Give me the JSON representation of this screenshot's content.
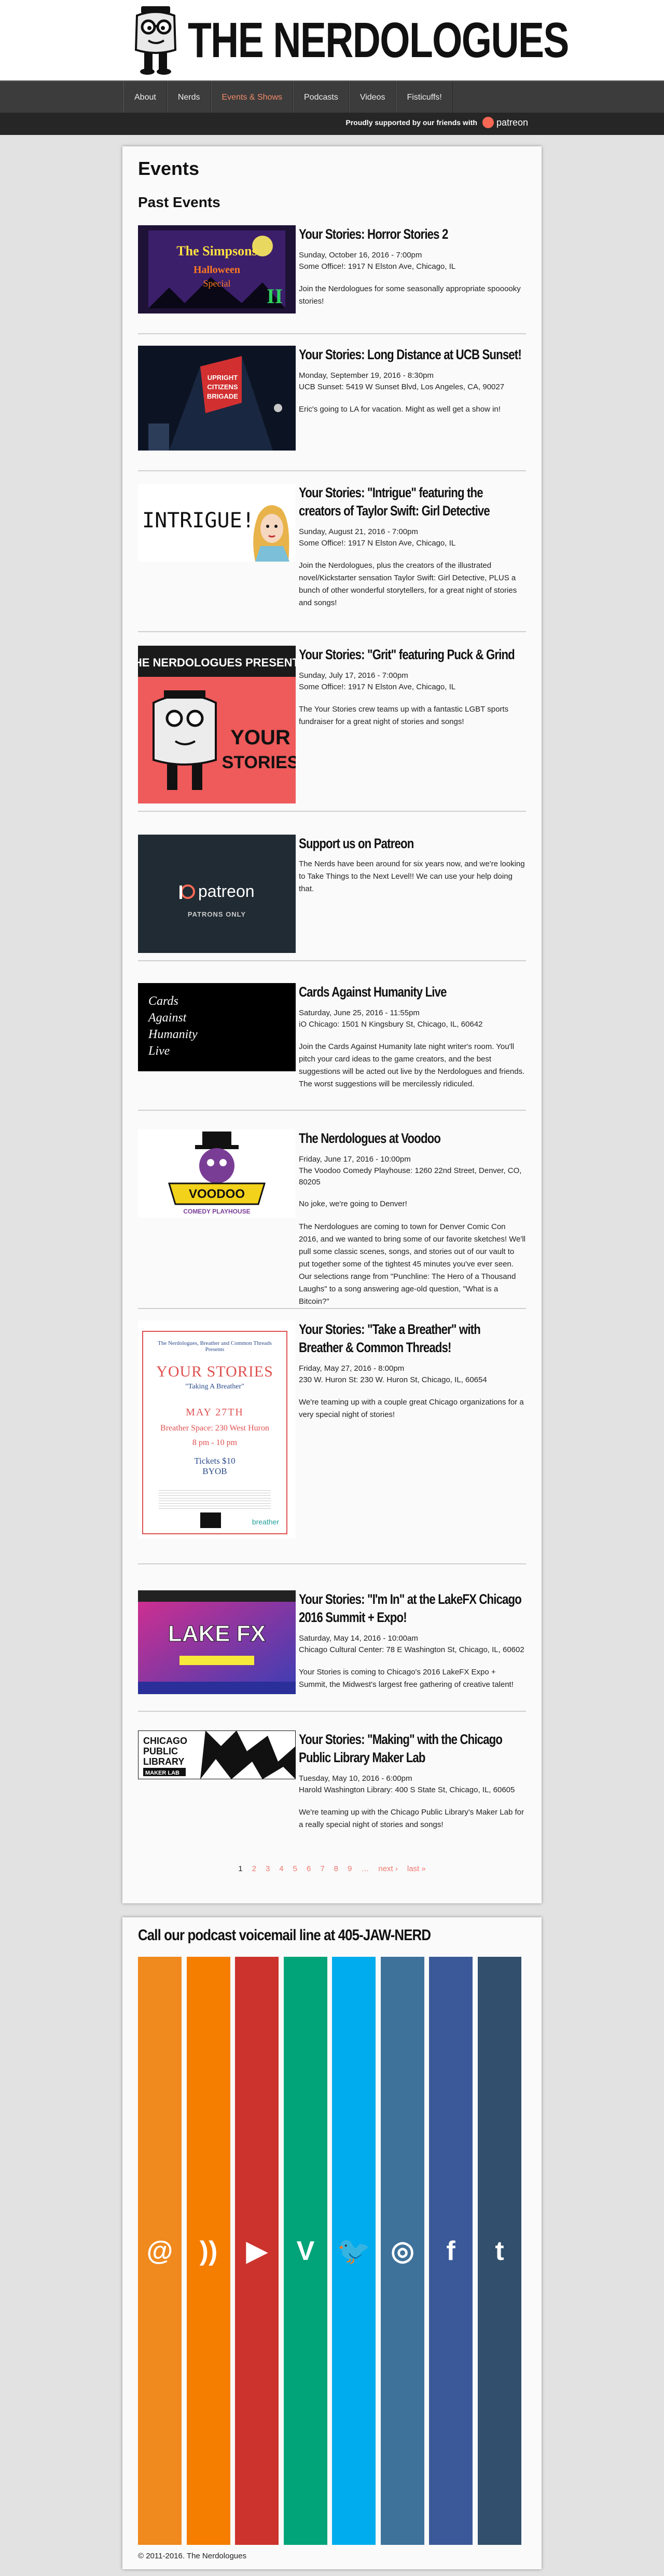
{
  "site": {
    "title": "THE NERDOLOGUES"
  },
  "nav": {
    "items": [
      "About",
      "Nerds",
      "Events & Shows",
      "Podcasts",
      "Videos",
      "Fisticuffs!"
    ],
    "active": 2
  },
  "sponsor": {
    "text": "Proudly supported by our friends with",
    "brand": "patreon",
    "brand_color": "#f96854"
  },
  "main": {
    "page_title": "Events",
    "section_title": "Past Events",
    "events": [
      {
        "title": "Your Stories: Horror Stories 2",
        "date": "Sunday, October 16, 2016 - 7:00pm",
        "location": "Some Office!: 1917 N Elston Ave, Chicago, IL",
        "description": "Join the Nerdologues for some seasonally appropriate spooooky stories!",
        "thumb_text": "The Simpsons Halloween Special"
      },
      {
        "title": "Your Stories: Long Distance at UCB Sunset!",
        "date": "Monday, September 19, 2016 - 8:30pm",
        "location": "UCB Sunset: 5419 W Sunset Blvd, Los Angeles, CA, 90027",
        "description": "Eric's going to LA for vacation. Might as well get a show in!",
        "thumb_text": "UPRIGHT CITIZENS BRIGADE"
      },
      {
        "title": "Your Stories: \"Intrigue\" featuring the creators of Taylor Swift: Girl Detective",
        "date": "Sunday, August 21, 2016 - 7:00pm",
        "location": "Some Office!: 1917 N Elston Ave, Chicago, IL",
        "description": "Join the Nerdologues, plus the creators of the illustrated novel/Kickstarter sensation Taylor Swift: Girl Detective, PLUS a bunch of other wonderful storytellers, for a great night of stories and songs!",
        "thumb_text": "INTRIGUE!"
      },
      {
        "title": "Your Stories: \"Grit\" featuring Puck & Grind",
        "date": "Sunday, July 17, 2016 - 7:00pm",
        "location": "Some Office!: 1917 N Elston Ave, Chicago, IL",
        "description": "The Your Stories crew teams up with a fantastic LGBT sports fundraiser for a great night of stories and songs!",
        "thumb_text_top": "THE NERDOLOGUES PRESENTS",
        "thumb_text_main": "YOUR STORIES"
      },
      {
        "title": "Support us on Patreon",
        "date": "",
        "location": "",
        "description": "The Nerds have been around for six years now, and we're looking to Take Things to the Next Level!! We can use your help doing that.",
        "thumb_text": "patreon",
        "thumb_sub": "PATRONS ONLY"
      },
      {
        "title": "Cards Against Humanity Live",
        "date": "Saturday, June 25, 2016 - 11:55pm",
        "location": "iO Chicago: 1501 N Kingsbury St, Chicago, IL, 60642",
        "description": "Join the Cards Against Humanity late night writer's room.  You'll pitch your card ideas to the game creators, and the best suggestions will be acted out live by the Nerdologues and friends. The worst suggestions will be mercilessly ridiculed.",
        "thumb_text": "Cards Against Humanity Live"
      },
      {
        "title": "The Nerdologues at Voodoo",
        "date": "Friday, June 17, 2016 - 10:00pm",
        "location": "The Voodoo Comedy Playhouse: 1260 22nd Street, Denver, CO, 80205",
        "description": "No joke, we're going to Denver!",
        "description2": "The Nerdologues are coming to town for Denver Comic Con 2016, and we wanted to bring some of our favorite sketches!  We'll pull some classic scenes, songs, and stories out of our vault to put together some of the tightest 45 minutes you've ever seen.  Our selections range from \"Punchline: The Hero of a Thousand Laughs\" to a song answering age-old question, \"What is a Bitcoin?\"",
        "thumb_text": "VOODOO",
        "thumb_sub": "COMEDY PLAYHOUSE"
      },
      {
        "title": "Your Stories: \"Take a Breather\" with Breather & Common Threads!",
        "date": "Friday, May 27, 2016 - 8:00pm",
        "location": "230 W. Huron St: 230 W. Huron St, Chicago, IL, 60654",
        "description": "We're teaming up with a couple great Chicago organizations for a very special night of stories!",
        "poster": {
          "header": "The Nerdologues, Breather and Common Threads Presents",
          "title": "YOUR STORIES",
          "subtitle": "\"Taking A Breather\"",
          "date": "MAY 27TH",
          "place": "Breather Space: 230 West Huron",
          "time": "8 pm - 10 pm",
          "tickets": "Tickets $10",
          "byob": "BYOB",
          "brand": "breather"
        }
      },
      {
        "title": "Your Stories: \"I'm In\" at the LakeFX Chicago 2016 Summit + Expo!",
        "date": "Saturday, May 14, 2016 - 10:00am",
        "location": "Chicago Cultural Center: 78 E Washington St, Chicago, IL, 60602",
        "description": "Your Stories is coming to Chicago's 2016 LakeFX Expo + Summit, the Midwest's largest free gathering of creative talent!",
        "thumb_text": "LAKE FX"
      },
      {
        "title": "Your Stories: \"Making\" with the Chicago Public Library Maker Lab",
        "date": "Tuesday, May 10, 2016 - 6:00pm",
        "location": "Harold Washington Library: 400 S State St, Chicago, IL, 60605",
        "description": "We're teaming up with the Chicago Public Library's Maker Lab for a really special night of stories and songs!",
        "thumb_text": "CHICAGO PUBLIC LIBRARY",
        "thumb_sub": "MAKER LAB"
      }
    ],
    "pager": {
      "pages": [
        "1",
        "2",
        "3",
        "4",
        "5",
        "6",
        "7",
        "8",
        "9",
        "…",
        "next ›",
        "last »"
      ],
      "current": 0
    }
  },
  "footer": {
    "voicemail": "Call our podcast voicemail line at 405-JAW-NERD",
    "social": [
      {
        "name": "email",
        "glyph": "@",
        "color": "#f0891e"
      },
      {
        "name": "rss",
        "glyph": "))",
        "color": "#f57d00"
      },
      {
        "name": "youtube",
        "glyph": "▶",
        "color": "#cd332d"
      },
      {
        "name": "vine",
        "glyph": "V",
        "color": "#00a478"
      },
      {
        "name": "twitter",
        "glyph": "🐦",
        "color": "#00aced"
      },
      {
        "name": "instagram",
        "glyph": "◎",
        "color": "#3f729b"
      },
      {
        "name": "facebook",
        "glyph": "f",
        "color": "#3b5998"
      },
      {
        "name": "tumblr",
        "glyph": "t",
        "color": "#32506d"
      }
    ],
    "copyright": "© 2011-2016. The Nerdologues"
  }
}
